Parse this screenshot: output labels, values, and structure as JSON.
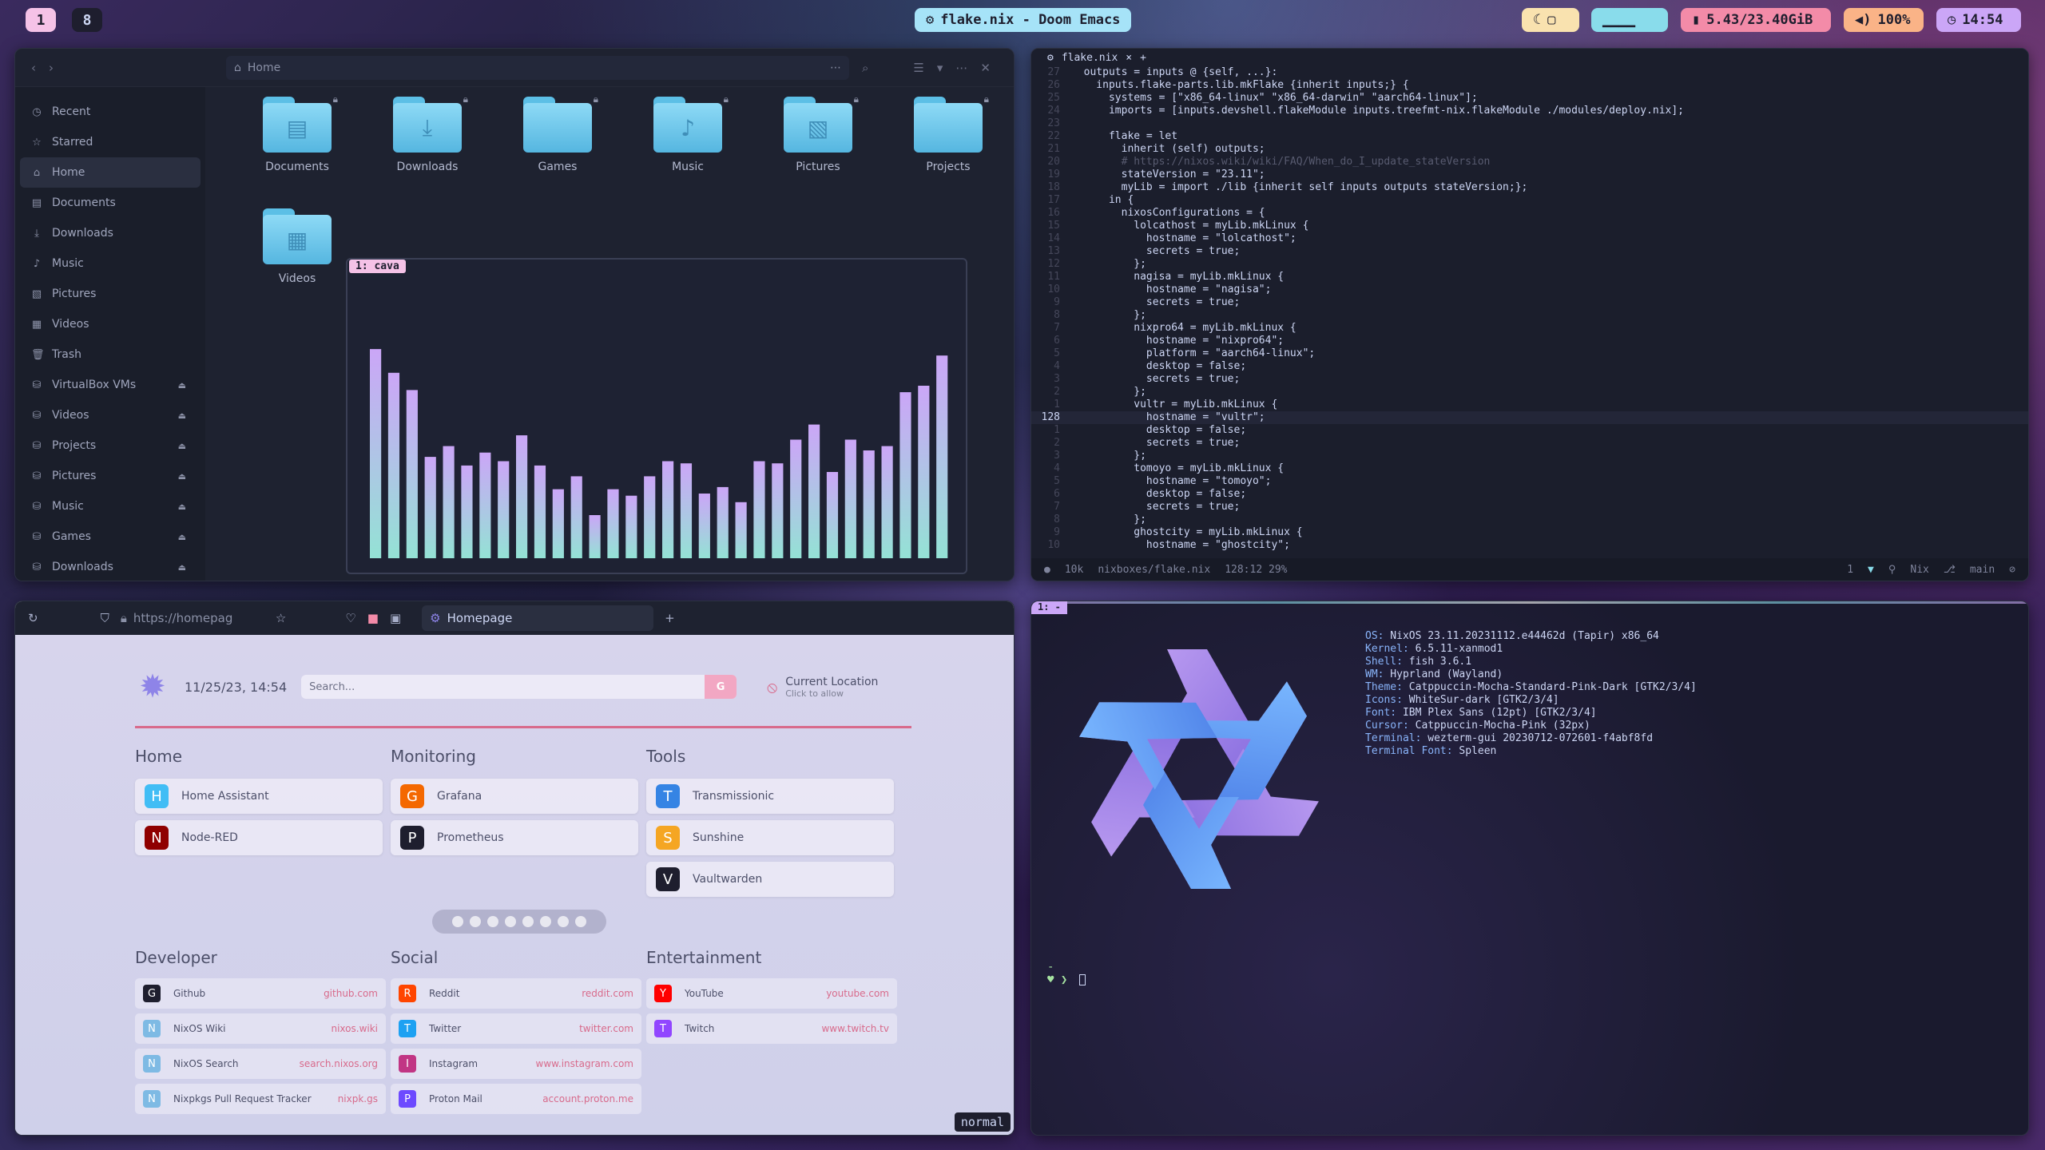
{
  "bar": {
    "ws1": "1",
    "ws8": "8",
    "title": "flake.nix - Doom Emacs",
    "memory": "5.43/23.40GiB",
    "volume": "100%",
    "clock": "14:54"
  },
  "files": {
    "location": "Home",
    "sidebar": [
      {
        "label": "Recent",
        "icon": "clock-icon",
        "eject": false
      },
      {
        "label": "Starred",
        "icon": "star-icon",
        "eject": false
      },
      {
        "label": "Home",
        "icon": "home-icon",
        "eject": false,
        "active": true
      },
      {
        "label": "Documents",
        "icon": "document-icon",
        "eject": false
      },
      {
        "label": "Downloads",
        "icon": "download-icon",
        "eject": false
      },
      {
        "label": "Music",
        "icon": "music-icon",
        "eject": false
      },
      {
        "label": "Pictures",
        "icon": "picture-icon",
        "eject": false
      },
      {
        "label": "Videos",
        "icon": "video-icon",
        "eject": false
      },
      {
        "label": "Trash",
        "icon": "trash-icon",
        "eject": false
      },
      {
        "label": "VirtualBox VMs",
        "icon": "drive-icon",
        "eject": true
      },
      {
        "label": "Videos",
        "icon": "drive-icon",
        "eject": true
      },
      {
        "label": "Projects",
        "icon": "drive-icon",
        "eject": true
      },
      {
        "label": "Pictures",
        "icon": "drive-icon",
        "eject": true
      },
      {
        "label": "Music",
        "icon": "drive-icon",
        "eject": true
      },
      {
        "label": "Games",
        "icon": "drive-icon",
        "eject": true
      },
      {
        "label": "Downloads",
        "icon": "drive-icon",
        "eject": true
      }
    ],
    "folders": [
      "Documents",
      "Downloads",
      "Games",
      "Music",
      "Pictures",
      "Projects",
      "Videos"
    ]
  },
  "cava": {
    "tag": "1: cava",
    "levels": [
      0.97,
      0.86,
      0.78,
      0.47,
      0.52,
      0.43,
      0.49,
      0.45,
      0.57,
      0.43,
      0.32,
      0.38,
      0.2,
      0.32,
      0.29,
      0.38,
      0.45,
      0.44,
      0.3,
      0.33,
      0.26,
      0.45,
      0.44,
      0.55,
      0.62,
      0.4,
      0.55,
      0.5,
      0.52,
      0.77,
      0.8,
      0.94
    ],
    "colors": {
      "top": "#cba6f7",
      "bottom": "#94e2d5"
    }
  },
  "emacs": {
    "tab": "flake.nix",
    "lines": [
      {
        "n": "27",
        "t": "  outputs = inputs @ {self, ...}:"
      },
      {
        "n": "26",
        "t": "    inputs.flake-parts.lib.mkFlake {inherit inputs;} {"
      },
      {
        "n": "25",
        "t": "      systems = [\"x86_64-linux\" \"x86_64-darwin\" \"aarch64-linux\"];"
      },
      {
        "n": "24",
        "t": "      imports = [inputs.devshell.flakeModule inputs.treefmt-nix.flakeModule ./modules/deploy.nix];"
      },
      {
        "n": "23",
        "t": ""
      },
      {
        "n": "22",
        "t": "      flake = let"
      },
      {
        "n": "21",
        "t": "        inherit (self) outputs;"
      },
      {
        "n": "20",
        "t": "        # https://nixos.wiki/wiki/FAQ/When_do_I_update_stateVersion"
      },
      {
        "n": "19",
        "t": "        stateVersion = \"23.11\";"
      },
      {
        "n": "18",
        "t": "        myLib = import ./lib {inherit self inputs outputs stateVersion;};"
      },
      {
        "n": "17",
        "t": "      in {"
      },
      {
        "n": "16",
        "t": "        nixosConfigurations = {"
      },
      {
        "n": "15",
        "t": "          lolcathost = myLib.mkLinux {"
      },
      {
        "n": "14",
        "t": "            hostname = \"lolcathost\";"
      },
      {
        "n": "13",
        "t": "            secrets = true;"
      },
      {
        "n": "12",
        "t": "          };"
      },
      {
        "n": "11",
        "t": "          nagisa = myLib.mkLinux {"
      },
      {
        "n": "10",
        "t": "            hostname = \"nagisa\";"
      },
      {
        "n": "9",
        "t": "            secrets = true;"
      },
      {
        "n": "8",
        "t": "          };"
      },
      {
        "n": "7",
        "t": "          nixpro64 = myLib.mkLinux {"
      },
      {
        "n": "6",
        "t": "            hostname = \"nixpro64\";"
      },
      {
        "n": "5",
        "t": "            platform = \"aarch64-linux\";"
      },
      {
        "n": "4",
        "t": "            desktop = false;"
      },
      {
        "n": "3",
        "t": "            secrets = true;"
      },
      {
        "n": "2",
        "t": "          };"
      },
      {
        "n": "1",
        "t": "          vultr = myLib.mkLinux {"
      },
      {
        "n": "128",
        "t": "            hostname = \"vultr\";",
        "cur": true
      },
      {
        "n": "1",
        "t": "            desktop = false;"
      },
      {
        "n": "2",
        "t": "            secrets = true;"
      },
      {
        "n": "3",
        "t": "          };"
      },
      {
        "n": "4",
        "t": "          tomoyo = myLib.mkLinux {"
      },
      {
        "n": "5",
        "t": "            hostname = \"tomoyo\";"
      },
      {
        "n": "6",
        "t": "            desktop = false;"
      },
      {
        "n": "7",
        "t": "            secrets = true;"
      },
      {
        "n": "8",
        "t": "          };"
      },
      {
        "n": "9",
        "t": "          ghostcity = myLib.mkLinux {"
      },
      {
        "n": "10",
        "t": "            hostname = \"ghostcity\";"
      }
    ],
    "modeline": {
      "size": "10k",
      "file": "nixboxes/flake.nix",
      "pos": "128:12 29%",
      "count": "1",
      "lang": "Nix",
      "branch": "main"
    }
  },
  "browser": {
    "url": "https://homepag",
    "tab": "Homepage",
    "mode": "normal",
    "page": {
      "date": "11/25/23, 14:54",
      "search_placeholder": "Search...",
      "search_button": "G",
      "loc_title": "Current Location",
      "loc_sub": "Click to allow",
      "groups": [
        {
          "title": "Home",
          "items": [
            {
              "label": "Home Assistant",
              "icon": "home-assistant-icon",
              "color": "#41bdf5"
            },
            {
              "label": "Node-RED",
              "icon": "node-red-icon",
              "color": "#8f0000"
            }
          ]
        },
        {
          "title": "Monitoring",
          "items": [
            {
              "label": "Grafana",
              "icon": "grafana-icon",
              "color": "#f46800"
            },
            {
              "label": "Prometheus",
              "icon": "prometheus-icon",
              "color": "#1e1e2e"
            }
          ]
        },
        {
          "title": "Tools",
          "items": [
            {
              "label": "Transmissionic",
              "icon": "transmission-icon",
              "color": "#3584e4"
            },
            {
              "label": "Sunshine",
              "icon": "sunshine-icon",
              "color": "#f5a623"
            },
            {
              "label": "Vaultwarden",
              "icon": "vaultwarden-icon",
              "color": "#1e1e2e"
            }
          ]
        }
      ],
      "links": [
        {
          "title": "Developer",
          "items": [
            {
              "label": "Github",
              "url": "github.com",
              "icon": "github-icon",
              "color": "#1e1e2e"
            },
            {
              "label": "NixOS Wiki",
              "url": "nixos.wiki",
              "icon": "nixos-icon",
              "color": "#7ebae4"
            },
            {
              "label": "NixOS Search",
              "url": "search.nixos.org",
              "icon": "nixos-icon",
              "color": "#7ebae4"
            },
            {
              "label": "Nixpkgs Pull Request Tracker",
              "url": "nixpk.gs",
              "icon": "nixos-icon",
              "color": "#7ebae4"
            }
          ]
        },
        {
          "title": "Social",
          "items": [
            {
              "label": "Reddit",
              "url": "reddit.com",
              "icon": "reddit-icon",
              "color": "#ff4500"
            },
            {
              "label": "Twitter",
              "url": "twitter.com",
              "icon": "twitter-icon",
              "color": "#1da1f2"
            },
            {
              "label": "Instagram",
              "url": "www.instagram.com",
              "icon": "instagram-icon",
              "color": "#c13584"
            },
            {
              "label": "Proton Mail",
              "url": "account.proton.me",
              "icon": "proton-icon",
              "color": "#6d4aff"
            }
          ]
        },
        {
          "title": "Entertainment",
          "items": [
            {
              "label": "YouTube",
              "url": "youtube.com",
              "icon": "youtube-icon",
              "color": "#ff0000"
            },
            {
              "label": "Twitch",
              "url": "www.twitch.tv",
              "icon": "twitch-icon",
              "color": "#9146ff"
            }
          ]
        }
      ]
    }
  },
  "terminal": {
    "tag": "1: -",
    "fetch": [
      {
        "k": "OS:",
        "v": " NixOS 23.11.20231112.e44462d (Tapir) x86_64"
      },
      {
        "k": "Kernel:",
        "v": " 6.5.11-xanmod1"
      },
      {
        "k": "Shell:",
        "v": " fish 3.6.1"
      },
      {
        "k": "WM:",
        "v": " Hyprland (Wayland)"
      },
      {
        "k": "Theme:",
        "v": " Catppuccin-Mocha-Standard-Pink-Dark [GTK2/3/4]"
      },
      {
        "k": "Icons:",
        "v": " WhiteSur-dark [GTK2/3/4]"
      },
      {
        "k": "Font:",
        "v": " IBM Plex Sans (12pt) [GTK2/3/4]"
      },
      {
        "k": "Cursor:",
        "v": " Catppuccin-Mocha-Pink (32px)"
      },
      {
        "k": "Terminal:",
        "v": " wezterm-gui 20230712-072601-f4abf8fd"
      },
      {
        "k": "Terminal Font:",
        "v": " Spleen"
      }
    ],
    "prompt_dash": "-",
    "prompt": "❯"
  }
}
